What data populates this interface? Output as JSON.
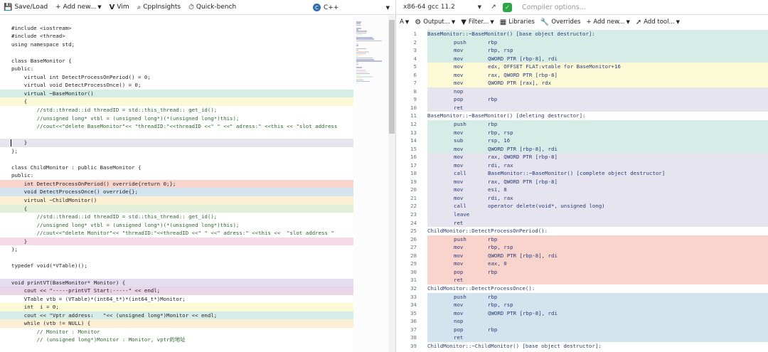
{
  "left_toolbar": {
    "save_load": "Save/Load",
    "add_new": "+ Add new...",
    "vim": "Vim",
    "cppinsights": "CppInsights",
    "quickbench": "Quick-bench",
    "language": "C++"
  },
  "source_lines": [
    {
      "text": "",
      "bg": ""
    },
    {
      "text": "#include <iostream>",
      "bg": ""
    },
    {
      "text": "#include <thread>",
      "bg": ""
    },
    {
      "text": "using namespace std;",
      "bg": ""
    },
    {
      "text": "",
      "bg": ""
    },
    {
      "text": "class BaseMonitor {",
      "bg": ""
    },
    {
      "text": "public:",
      "bg": ""
    },
    {
      "text": "    virtual int DetectProcessOnPeriod() = 0;",
      "bg": ""
    },
    {
      "text": "    virtual void DetectProcessOnce() = 0;",
      "bg": ""
    },
    {
      "text": "    virtual ~BaseMonitor()",
      "bg": "#d5ede6"
    },
    {
      "text": "    {",
      "bg": "#fbf9d6"
    },
    {
      "text": "        //std::thread::id threadID = std::this_thread:: get_id();",
      "bg": ""
    },
    {
      "text": "        //unsigned long* vtbl = (unsigned long*)(*(unsigned long*)this);",
      "bg": ""
    },
    {
      "text": "        //cout<<\"delete BaseMonitor\"<< \"threadID:\"<<threadID <<\" \" <<\" adress:\" <<this << \"slot address",
      "bg": ""
    },
    {
      "text": "",
      "bg": ""
    },
    {
      "text": "    }",
      "bg": "#e6e4ef"
    },
    {
      "text": "};",
      "bg": ""
    },
    {
      "text": "",
      "bg": ""
    },
    {
      "text": "class ChildMonitor : public BaseMonitor {",
      "bg": ""
    },
    {
      "text": "public:",
      "bg": ""
    },
    {
      "text": "    int DetectProcessOnPeriod() override{return 0;};",
      "bg": "#f9d4cc"
    },
    {
      "text": "    void DetectProcessOnce() override{};",
      "bg": "#d3e4ef"
    },
    {
      "text": "    virtual ~ChildMonitor()",
      "bg": "#fbf0d5"
    },
    {
      "text": "    {",
      "bg": "#e2f0da"
    },
    {
      "text": "        //std::thread::id threadID = std::this_thread:: get_id();",
      "bg": ""
    },
    {
      "text": "        //unsigned long* vtbl = (unsigned long*)(*(unsigned long*)this);",
      "bg": ""
    },
    {
      "text": "        //cout<<\"delete Monitor\"<< \"threadID:\"<<threadID <<\" \" <<\" adress:\" <<this <<  \"slot address \"",
      "bg": ""
    },
    {
      "text": "    }",
      "bg": "#f6dbe6"
    },
    {
      "text": "};",
      "bg": ""
    },
    {
      "text": "",
      "bg": ""
    },
    {
      "text": "typedef void(*VTable)();",
      "bg": ""
    },
    {
      "text": "",
      "bg": ""
    },
    {
      "text": "void printVT(BaseMonitor* Monitor) {",
      "bg": "#e4ddef"
    },
    {
      "text": "    cout << \"-----printVT Start:-----\" << endl;",
      "bg": "#ead5e8"
    },
    {
      "text": "    VTable vtb = (VTable)*(int64_t*)*(int64_t*)Monitor;",
      "bg": ""
    },
    {
      "text": "    int  i = 0;",
      "bg": "#fbf9d6"
    },
    {
      "text": "    cout << \"Vptr address:   \"<< (unsigned long*)Monitor << endl;",
      "bg": "#d5ede6"
    },
    {
      "text": "    while (vtb != NULL) {",
      "bg": "#fbf0d5"
    },
    {
      "text": "        // Monitor : Monitor",
      "bg": ""
    },
    {
      "text": "        // (unsigned long*)Monitor : Monitor, vptr的地址",
      "bg": ""
    }
  ],
  "right_top": {
    "compiler": "x86-64 gcc 11.2",
    "compiler_options_placeholder": "Compiler options..."
  },
  "right_toolbar": {
    "font": "A",
    "output": "Output...",
    "filter": "Filter...",
    "libraries": "Libraries",
    "overrides": "Overrides",
    "add_new": "+ Add new...",
    "add_tool": "Add tool..."
  },
  "asm_lines": [
    {
      "n": "1",
      "label": "BaseMonitor::~BaseMonitor() [base object destructor]:",
      "instr": "",
      "ops": "",
      "bg": "#d5ede6"
    },
    {
      "n": "2",
      "label": "",
      "instr": "push",
      "ops": "rbp",
      "bg": "#d5ede6"
    },
    {
      "n": "3",
      "label": "",
      "instr": "mov",
      "ops": "rbp, rsp",
      "bg": "#d5ede6"
    },
    {
      "n": "4",
      "label": "",
      "instr": "mov",
      "ops": "QWORD PTR [rbp-8], rdi",
      "bg": "#d5ede6"
    },
    {
      "n": "5",
      "label": "",
      "instr": "mov",
      "ops": "edx, OFFSET FLAT:vtable for BaseMonitor+16",
      "bg": "#fbf9d6"
    },
    {
      "n": "6",
      "label": "",
      "instr": "mov",
      "ops": "rax, QWORD PTR [rbp-8]",
      "bg": "#fbf9d6"
    },
    {
      "n": "7",
      "label": "",
      "instr": "mov",
      "ops": "QWORD PTR [rax], rdx",
      "bg": "#fbf9d6"
    },
    {
      "n": "8",
      "label": "",
      "instr": "nop",
      "ops": "",
      "bg": "#e6e4ef"
    },
    {
      "n": "9",
      "label": "",
      "instr": "pop",
      "ops": "rbp",
      "bg": "#e6e4ef"
    },
    {
      "n": "10",
      "label": "",
      "instr": "ret",
      "ops": "",
      "bg": "#e6e4ef"
    },
    {
      "n": "11",
      "label": "BaseMonitor::~BaseMonitor() [deleting destructor]:",
      "instr": "",
      "ops": "",
      "bg": ""
    },
    {
      "n": "12",
      "label": "",
      "instr": "push",
      "ops": "rbp",
      "bg": "#d5ede6"
    },
    {
      "n": "13",
      "label": "",
      "instr": "mov",
      "ops": "rbp, rsp",
      "bg": "#d5ede6"
    },
    {
      "n": "14",
      "label": "",
      "instr": "sub",
      "ops": "rsp, 16",
      "bg": "#d5ede6"
    },
    {
      "n": "15",
      "label": "",
      "instr": "mov",
      "ops": "QWORD PTR [rbp-8], rdi",
      "bg": "#d5ede6"
    },
    {
      "n": "16",
      "label": "",
      "instr": "mov",
      "ops": "rax, QWORD PTR [rbp-8]",
      "bg": "#e6e4ef"
    },
    {
      "n": "17",
      "label": "",
      "instr": "mov",
      "ops": "rdi, rax",
      "bg": "#e6e4ef"
    },
    {
      "n": "18",
      "label": "",
      "instr": "call",
      "ops": "BaseMonitor::~BaseMonitor() [complete object destructor]",
      "bg": "#e6e4ef"
    },
    {
      "n": "19",
      "label": "",
      "instr": "mov",
      "ops": "rax, QWORD PTR [rbp-8]",
      "bg": "#e6e4ef"
    },
    {
      "n": "20",
      "label": "",
      "instr": "mov",
      "ops": "esi, 8",
      "bg": "#e6e4ef"
    },
    {
      "n": "21",
      "label": "",
      "instr": "mov",
      "ops": "rdi, rax",
      "bg": "#e6e4ef"
    },
    {
      "n": "22",
      "label": "",
      "instr": "call",
      "ops": "operator delete(void*, unsigned long)",
      "bg": "#e6e4ef"
    },
    {
      "n": "23",
      "label": "",
      "instr": "leave",
      "ops": "",
      "bg": "#e6e4ef"
    },
    {
      "n": "24",
      "label": "",
      "instr": "ret",
      "ops": "",
      "bg": "#e6e4ef"
    },
    {
      "n": "25",
      "label": "ChildMonitor::DetectProcessOnPeriod():",
      "instr": "",
      "ops": "",
      "bg": ""
    },
    {
      "n": "26",
      "label": "",
      "instr": "push",
      "ops": "rbp",
      "bg": "#f9d4cc"
    },
    {
      "n": "27",
      "label": "",
      "instr": "mov",
      "ops": "rbp, rsp",
      "bg": "#f9d4cc"
    },
    {
      "n": "28",
      "label": "",
      "instr": "mov",
      "ops": "QWORD PTR [rbp-8], rdi",
      "bg": "#f9d4cc"
    },
    {
      "n": "29",
      "label": "",
      "instr": "mov",
      "ops": "eax, 0",
      "bg": "#f9d4cc"
    },
    {
      "n": "30",
      "label": "",
      "instr": "pop",
      "ops": "rbp",
      "bg": "#f9d4cc"
    },
    {
      "n": "31",
      "label": "",
      "instr": "ret",
      "ops": "",
      "bg": "#f9d4cc"
    },
    {
      "n": "32",
      "label": "ChildMonitor::DetectProcessOnce():",
      "instr": "",
      "ops": "",
      "bg": ""
    },
    {
      "n": "33",
      "label": "",
      "instr": "push",
      "ops": "rbp",
      "bg": "#d3e4ef"
    },
    {
      "n": "34",
      "label": "",
      "instr": "mov",
      "ops": "rbp, rsp",
      "bg": "#d3e4ef"
    },
    {
      "n": "35",
      "label": "",
      "instr": "mov",
      "ops": "QWORD PTR [rbp-8], rdi",
      "bg": "#d3e4ef"
    },
    {
      "n": "36",
      "label": "",
      "instr": "nop",
      "ops": "",
      "bg": "#d3e4ef"
    },
    {
      "n": "37",
      "label": "",
      "instr": "pop",
      "ops": "rbp",
      "bg": "#d3e4ef"
    },
    {
      "n": "38",
      "label": "",
      "instr": "ret",
      "ops": "",
      "bg": "#d3e4ef"
    },
    {
      "n": "39",
      "label": "ChildMonitor::~ChildMonitor() [base object destructor]:",
      "instr": "",
      "ops": "",
      "bg": ""
    }
  ],
  "colors": {
    "run_ok": "#28a745",
    "lang_icon": "#2f6fb0"
  }
}
